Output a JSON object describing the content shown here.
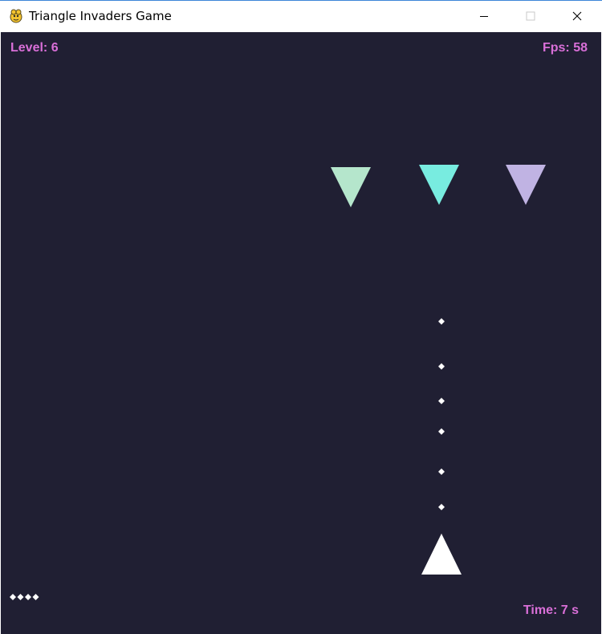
{
  "window": {
    "title": "Triangle Invaders Game"
  },
  "hud": {
    "level": "Level: 6",
    "fps": "Fps: 58",
    "time": "Time: 7 s",
    "lives_remaining": 4
  },
  "enemies": [
    {
      "color": "#b5e6cc"
    },
    {
      "color": "#78ece0"
    },
    {
      "color": "#c0b3e3"
    }
  ],
  "player_bullet_count": 6,
  "colors": {
    "background": "#201f33",
    "hud_text": "#d96fd8",
    "player": "#ffffff",
    "bullet": "#ffffff"
  },
  "icons": {
    "app": "pygame-snake-icon",
    "minimize": "minimize-icon",
    "maximize": "maximize-icon",
    "close": "close-icon"
  }
}
